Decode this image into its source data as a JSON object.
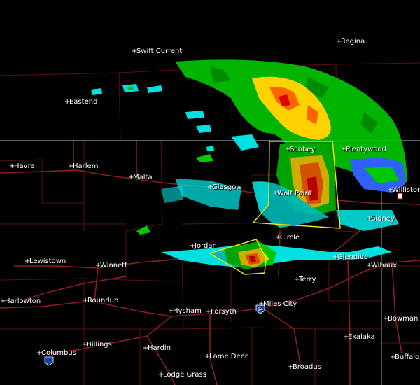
{
  "map": {
    "background": "#000000",
    "border_color": "#c0c0c0",
    "county_line_color": "#5a0f10",
    "road_color": "#8b1e1e",
    "warning_polygon_color": "#ffff00",
    "radar_colors": {
      "light": "#00c800",
      "moderate": "#ffd200",
      "heavy": "#ff6400",
      "intense": "#e00000",
      "very_light": "#00e0e0",
      "trace": "#3060ff"
    },
    "interstate_shield": "94",
    "cities": [
      {
        "name": "Swift Current"
      },
      {
        "name": "Regina"
      },
      {
        "name": "Eastend"
      },
      {
        "name": "Scobey"
      },
      {
        "name": "Plentywood"
      },
      {
        "name": "Havre"
      },
      {
        "name": "Harlem"
      },
      {
        "name": "Malta"
      },
      {
        "name": "Glasgow"
      },
      {
        "name": "Wolf Point"
      },
      {
        "name": "Williston"
      },
      {
        "name": "Sidney"
      },
      {
        "name": "Circle"
      },
      {
        "name": "Jordan"
      },
      {
        "name": "Glendive"
      },
      {
        "name": "Wibaux"
      },
      {
        "name": "Lewistown"
      },
      {
        "name": "Winnett"
      },
      {
        "name": "Terry"
      },
      {
        "name": "Harlowton"
      },
      {
        "name": "Roundup"
      },
      {
        "name": "Hysham"
      },
      {
        "name": "Forsyth"
      },
      {
        "name": "Miles City"
      },
      {
        "name": "Bowman"
      },
      {
        "name": "Ekalaka"
      },
      {
        "name": "Columbus"
      },
      {
        "name": "Billings"
      },
      {
        "name": "Hardin"
      },
      {
        "name": "Lame Deer"
      },
      {
        "name": "Broadus"
      },
      {
        "name": "Buffalo"
      },
      {
        "name": "Lodge Grass"
      }
    ]
  }
}
